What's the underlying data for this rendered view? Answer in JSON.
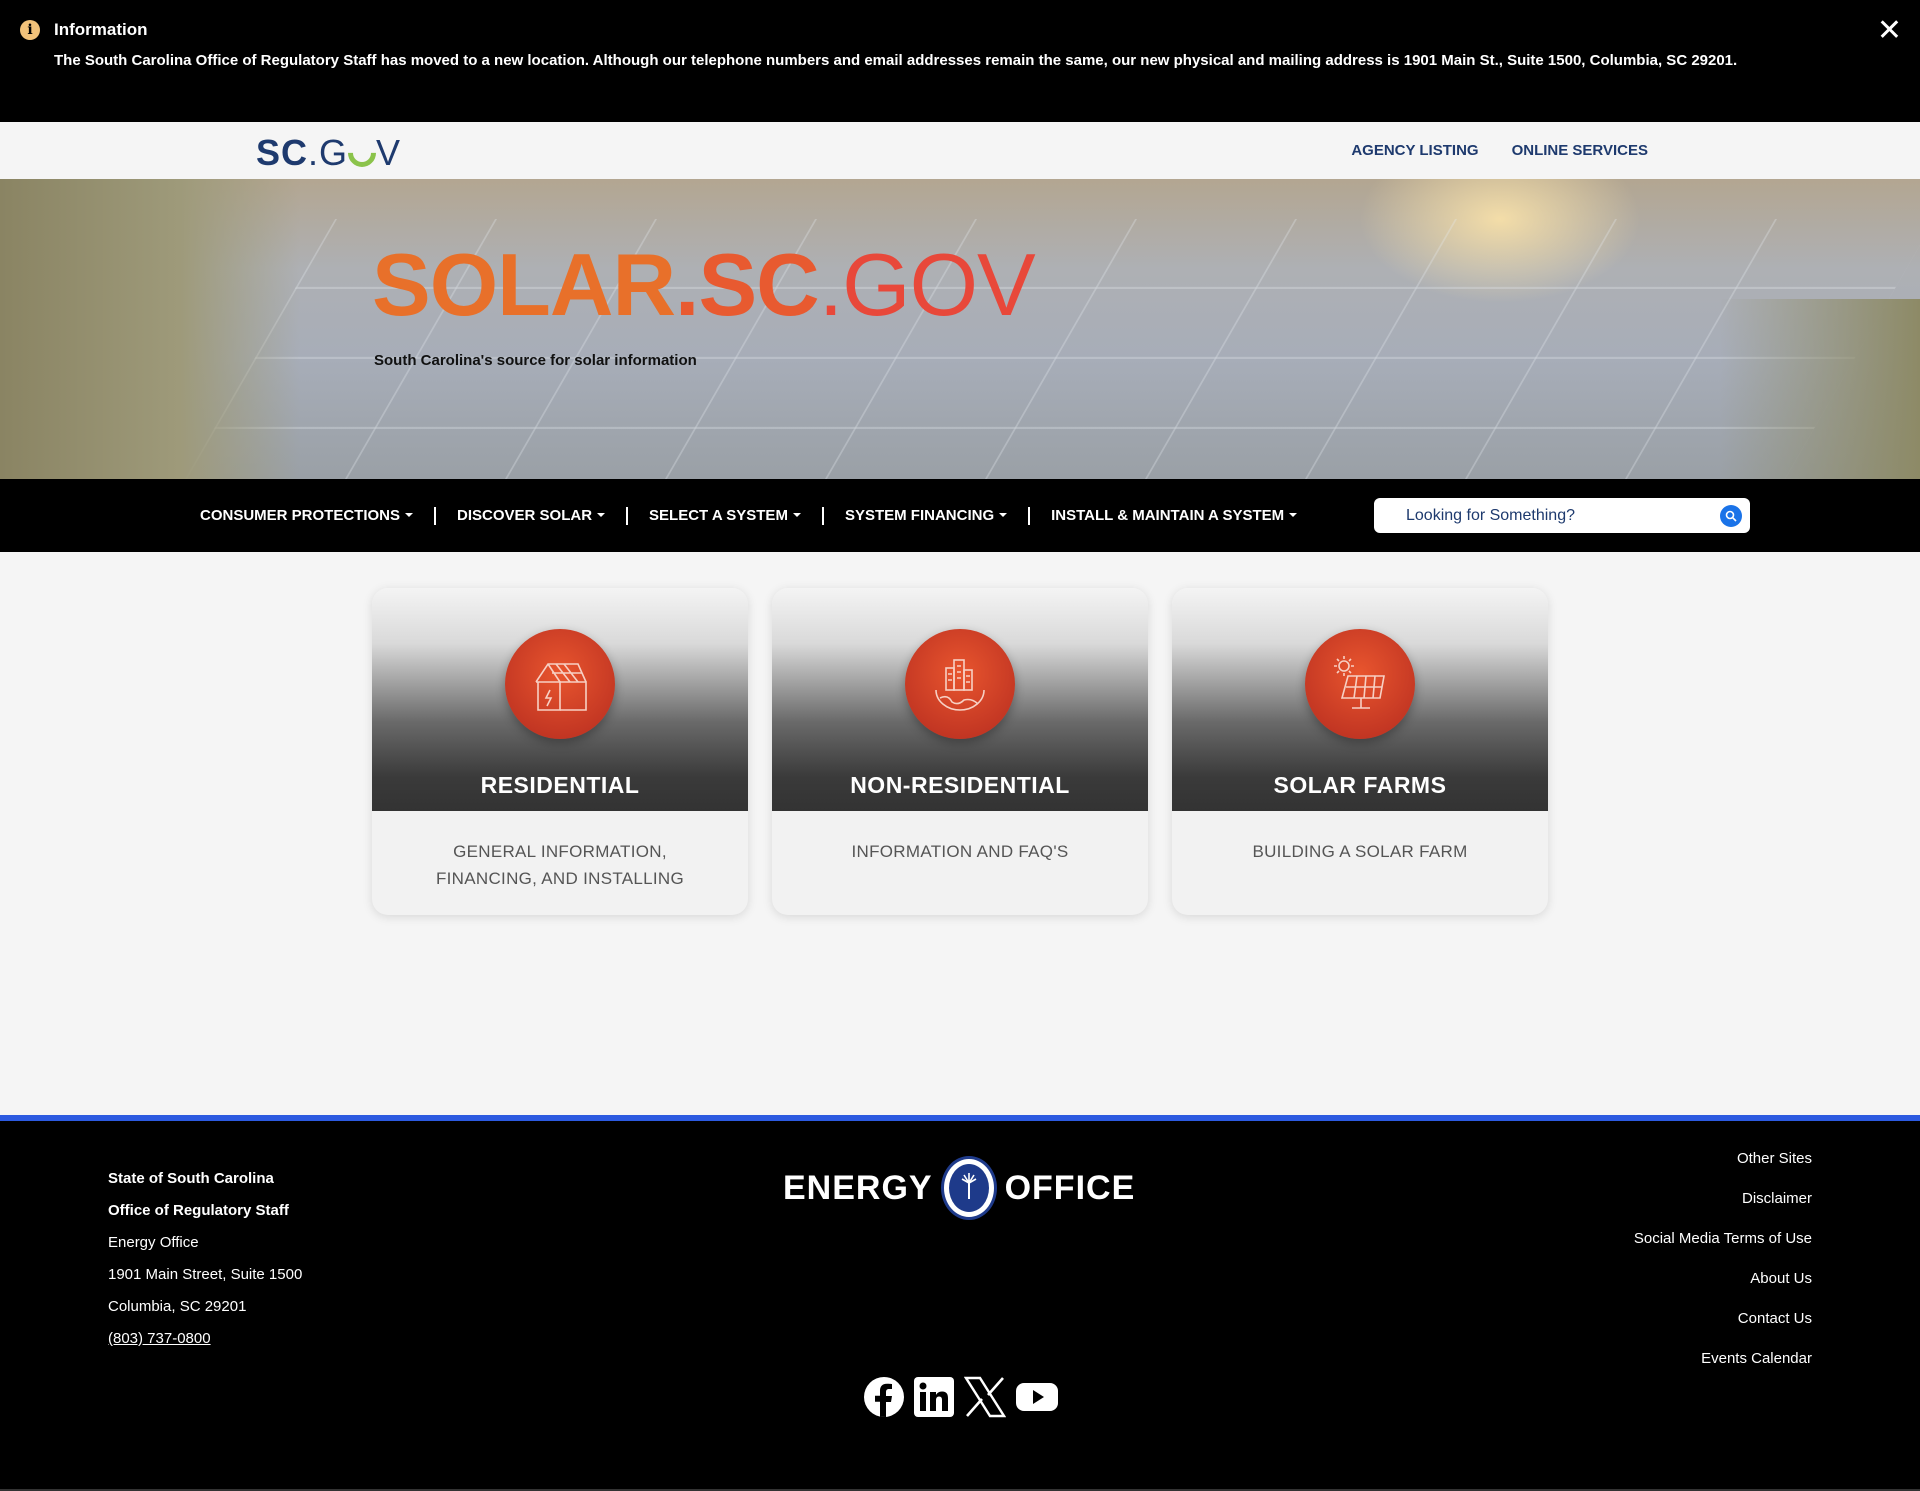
{
  "alert": {
    "icon": "info-icon",
    "title": "Information",
    "message": "The South Carolina Office of Regulatory Staff has moved to a new location. Although our telephone numbers and email addresses remain the same, our new physical and mailing address is 1901 Main St., Suite 1500, Columbia, SC 29201.",
    "close": "✕"
  },
  "topbar": {
    "logo_sc": "SC",
    "logo_dot": ".",
    "logo_g": "G",
    "logo_v": "V",
    "links": [
      "AGENCY LISTING",
      "ONLINE SERVICES"
    ]
  },
  "hero": {
    "title_1": "SOLAR",
    "title_dot1": ".",
    "title_2": "SC",
    "title_dot2": ".",
    "title_3": "GOV",
    "subtitle": "South Carolina's source for solar information"
  },
  "nav": {
    "items": [
      "CONSUMER PROTECTIONS",
      "DISCOVER SOLAR",
      "SELECT A SYSTEM",
      "SYSTEM FINANCING",
      "INSTALL & MAINTAIN A SYSTEM"
    ],
    "search_placeholder": "Looking for Something?"
  },
  "cards": [
    {
      "title": "RESIDENTIAL",
      "desc": "GENERAL INFORMATION, FINANCING, AND INSTALLING",
      "icon": "house-icon"
    },
    {
      "title": "NON-RESIDENTIAL",
      "desc": "INFORMATION AND FAQ'S",
      "icon": "city-globe-icon"
    },
    {
      "title": "SOLAR FARMS",
      "desc": "BUILDING A SOLAR FARM",
      "icon": "solar-panel-icon"
    }
  ],
  "footer": {
    "address": {
      "line1": "State of South Carolina",
      "line2": "Office of Regulatory Staff",
      "line3": "Energy Office",
      "line4": "1901 Main Street, Suite 1500",
      "line5": "Columbia, SC 29201",
      "phone": "(803) 737-0800"
    },
    "logo_left": "ENERGY",
    "logo_right": "OFFICE",
    "links": [
      "Other Sites",
      "Disclaimer",
      "Social Media Terms of Use",
      "About Us",
      "Contact Us",
      "Events Calendar"
    ],
    "social": [
      "facebook-icon",
      "linkedin-icon",
      "x-icon",
      "youtube-icon"
    ]
  },
  "colors": {
    "accent_orange": "#e8702a",
    "accent_red": "#e8483a",
    "navy": "#1e3a6e",
    "footer_rule": "#2c5ae0"
  }
}
